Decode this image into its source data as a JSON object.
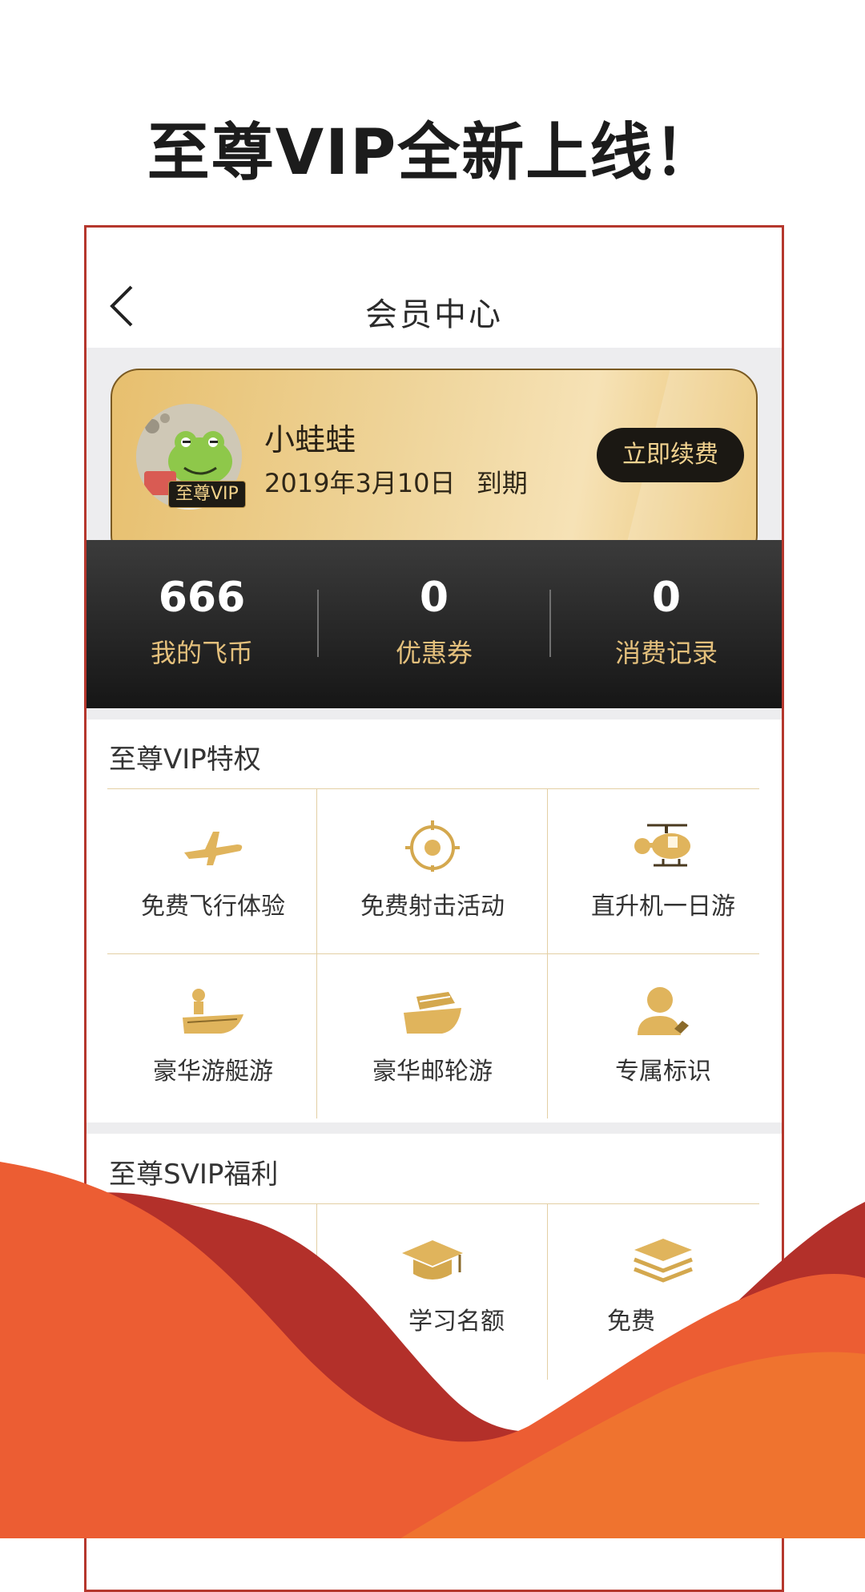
{
  "headline": "至尊VIP全新上线！",
  "nav": {
    "title": "会员中心"
  },
  "profile": {
    "name": "小蛙蛙",
    "badge": "至尊VIP",
    "expiry_date": "2019年3月10日",
    "expiry_suffix": "到期",
    "renew_label": "立即续费"
  },
  "stats": [
    {
      "value": "666",
      "label": "我的飞币"
    },
    {
      "value": "0",
      "label": "优惠券"
    },
    {
      "value": "0",
      "label": "消费记录"
    }
  ],
  "vip_section": {
    "title": "至尊VIP特权",
    "items": [
      {
        "label": "免费飞行体验",
        "icon": "airplane-icon"
      },
      {
        "label": "免费射击活动",
        "icon": "target-icon"
      },
      {
        "label": "直升机一日游",
        "icon": "helicopter-icon"
      },
      {
        "label": "豪华游艇游",
        "icon": "speedboat-icon"
      },
      {
        "label": "豪华邮轮游",
        "icon": "cruise-ship-icon"
      },
      {
        "label": "专属标识",
        "icon": "user-badge-icon"
      }
    ]
  },
  "svip_section": {
    "title": "至尊SVIP福利",
    "items": [
      {
        "label": "",
        "icon": ""
      },
      {
        "label": "学习名额",
        "icon": "graduation-cap-icon"
      },
      {
        "label": "免费",
        "icon": "layers-icon"
      }
    ]
  },
  "colors": {
    "accent_gold": "#e4c07c",
    "frame_red": "#b5372d",
    "wave_orange": "#ec5d33",
    "wave_red": "#b3302a"
  }
}
